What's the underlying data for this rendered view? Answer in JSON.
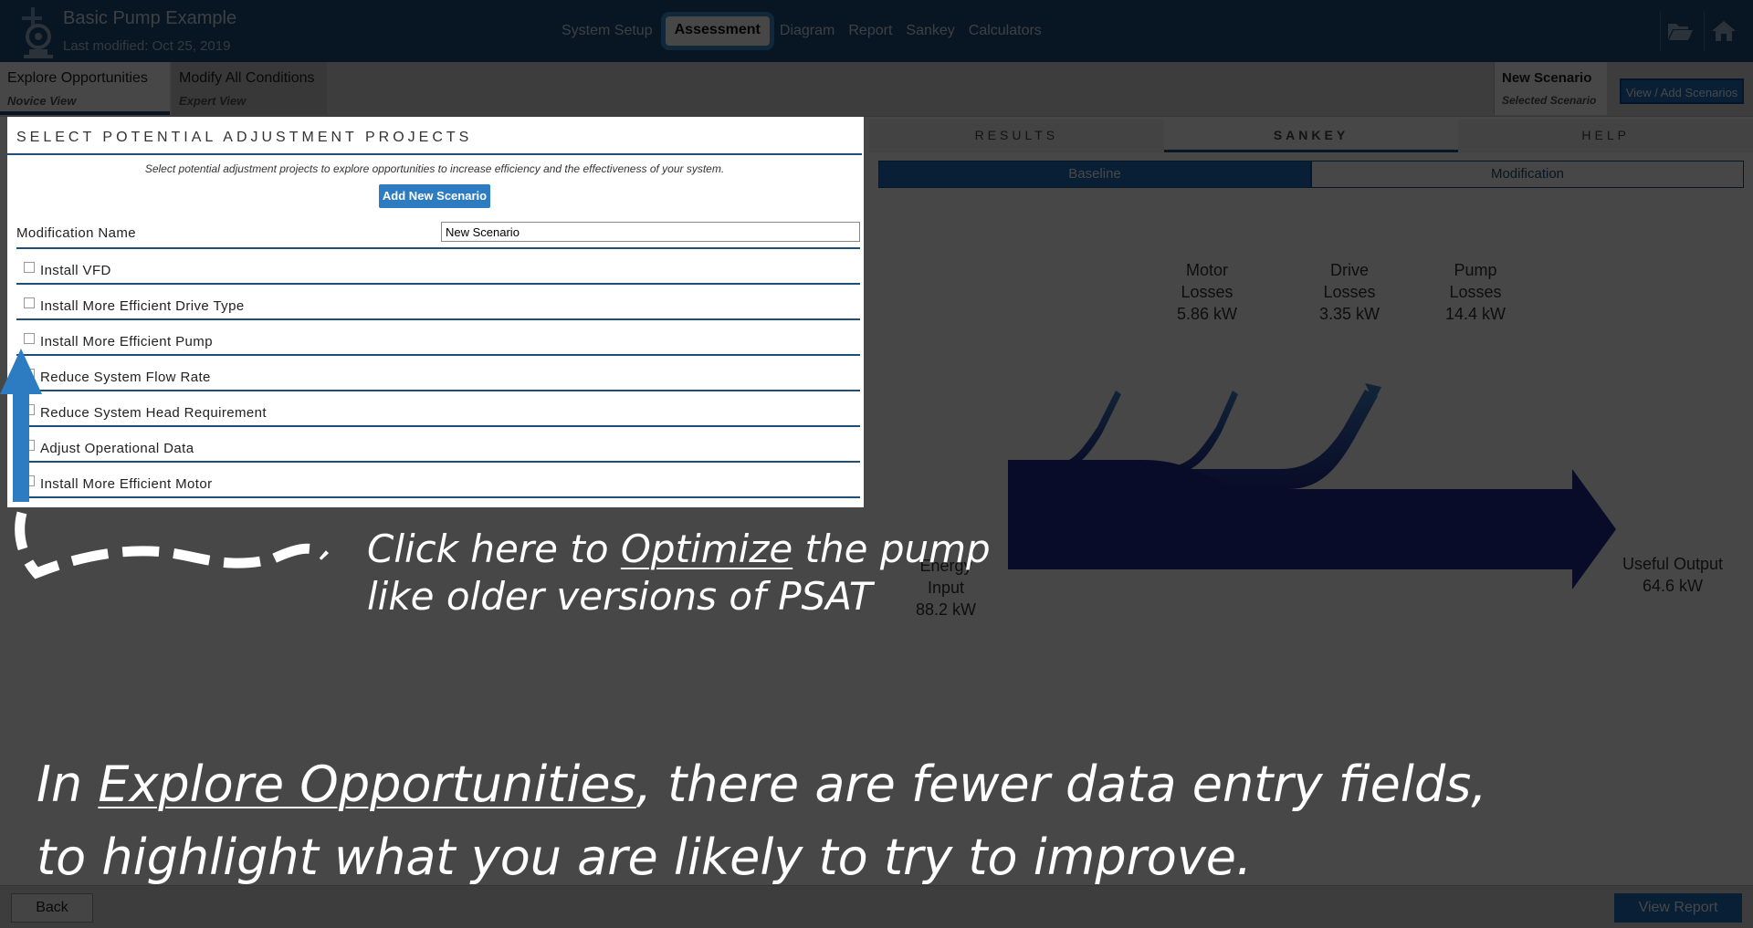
{
  "header": {
    "title": "Basic Pump Example",
    "subtitle": "Last modified: Oct 25, 2019",
    "nav": [
      "System Setup",
      "Assessment",
      "Diagram",
      "Report",
      "Sankey",
      "Calculators"
    ],
    "active_nav": "Assessment",
    "icons": [
      "folder-open-icon",
      "home-icon"
    ]
  },
  "tabs": {
    "explore": {
      "label": "Explore Opportunities",
      "sub": "Novice View"
    },
    "modify": {
      "label": "Modify All Conditions",
      "sub": "Expert View"
    }
  },
  "scenario": {
    "name": "New Scenario",
    "sub": "Selected Scenario",
    "view_add_label": "View / Add Scenarios"
  },
  "left": {
    "title": "SELECT POTENTIAL ADJUSTMENT PROJECTS",
    "description": "Select potential adjustment projects to explore opportunities to increase efficiency and the effectiveness of your system.",
    "add_button": "Add New Scenario",
    "mod_name_label": "Modification Name",
    "mod_name_value": "New Scenario",
    "options": [
      "Install VFD",
      "Install More Efficient Drive Type",
      "Install More Efficient Pump",
      "Reduce System Flow Rate",
      "Reduce System Head Requirement",
      "Adjust Operational Data",
      "Install More Efficient Motor"
    ]
  },
  "right": {
    "tabs": [
      "RESULTS",
      "SANKEY",
      "HELP"
    ],
    "active_tab": "SANKEY",
    "subtabs": [
      "Baseline",
      "Modification"
    ],
    "active_subtab": "Baseline",
    "sankey": {
      "losses": [
        {
          "name": "Motor Losses",
          "value": "5.86 kW"
        },
        {
          "name": "Drive Losses",
          "value": "3.35 kW"
        },
        {
          "name": "Pump Losses",
          "value": "14.4 kW"
        }
      ],
      "input": {
        "name": "Energy Input",
        "value": "88.2 kW"
      },
      "output": {
        "name": "Useful Output",
        "value": "64.6 kW"
      },
      "colors": {
        "flow": "#1f2c8f",
        "flow_dark": "#161f72",
        "loss": "#2f5fa8"
      }
    }
  },
  "footer": {
    "back": "Back",
    "view_report": "View Report"
  },
  "annotations": {
    "arrow_line1_pre": "Click here to ",
    "arrow_line1_u": "Optimize",
    "arrow_line1_post": " the pump",
    "arrow_line2": "like older versions of PSAT",
    "bottom_line1_pre": "In ",
    "bottom_line1_u": "Explore Opportunities",
    "bottom_line1_post": ", there are fewer data entry fields,",
    "bottom_line2": "to highlight what you are likely to try to improve."
  }
}
